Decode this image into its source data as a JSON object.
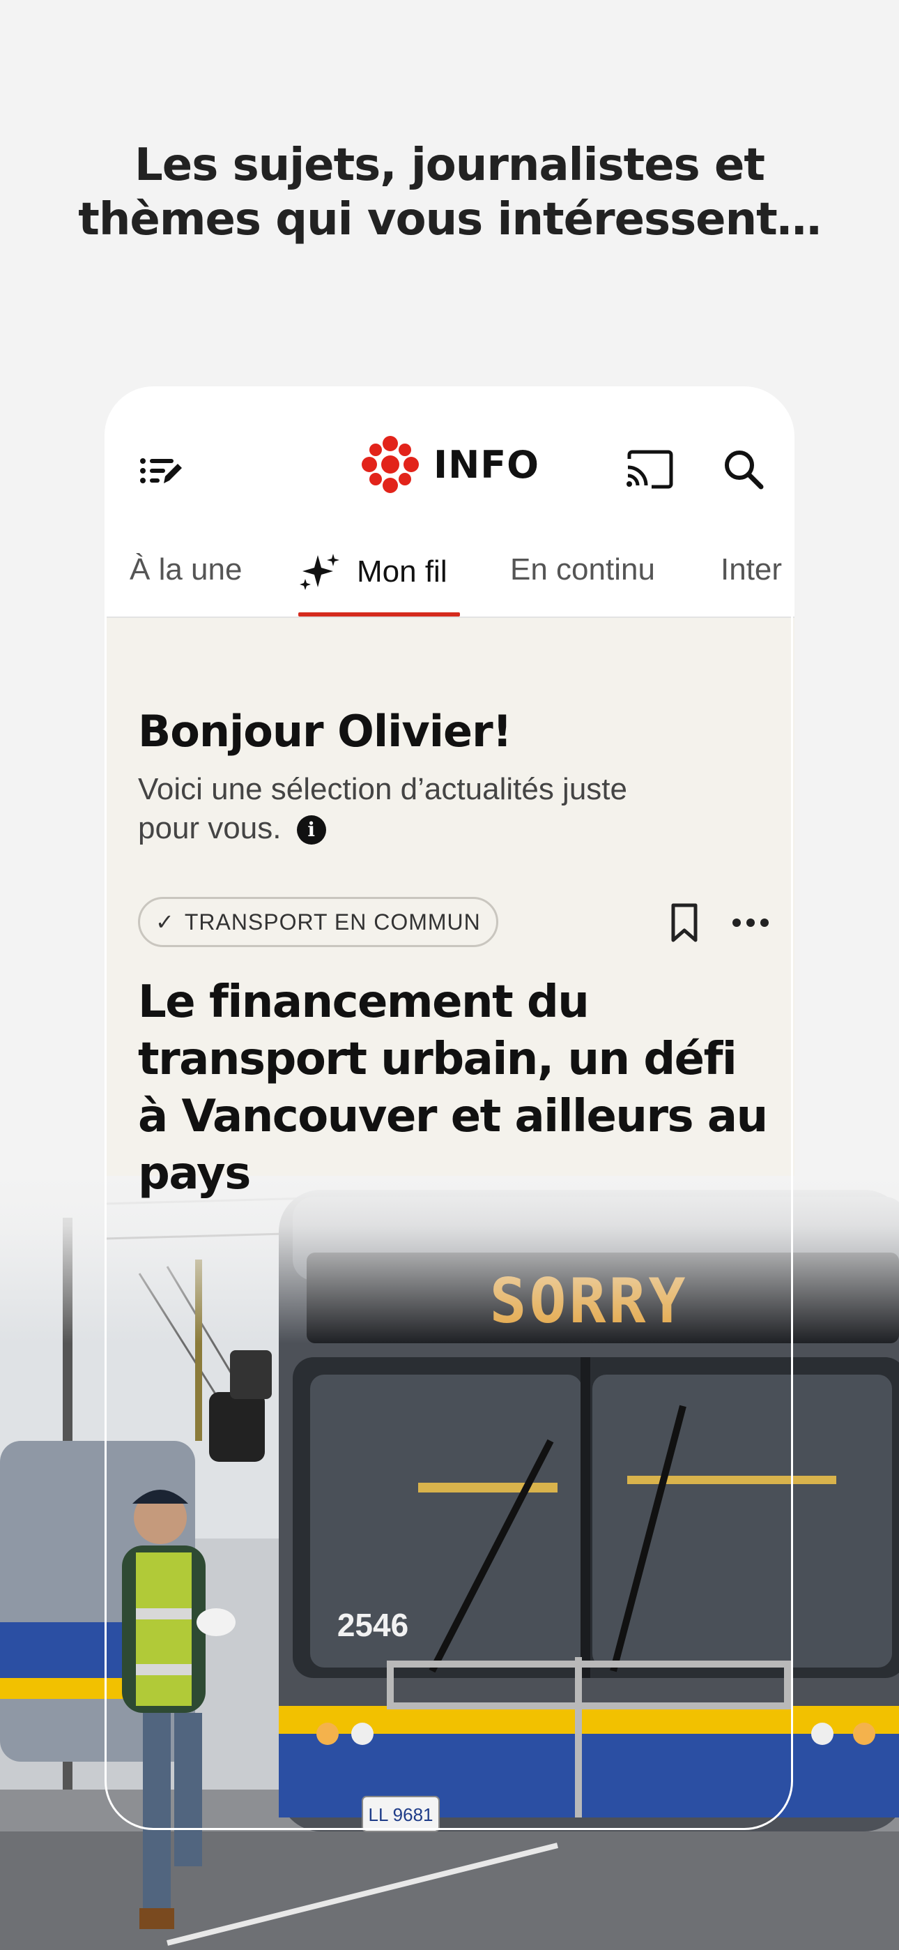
{
  "promo": {
    "title_line1": "Les sujets, journalistes et",
    "title_line2": "thèmes qui vous intéressent…"
  },
  "app": {
    "brand": "INFO",
    "icons": [
      "menu-edit-icon",
      "cast-icon",
      "search-icon"
    ],
    "accent_color": "#d52b1e"
  },
  "tabs": [
    {
      "label": "À la une",
      "active": false
    },
    {
      "label": "Mon fil",
      "active": true
    },
    {
      "label": "En continu",
      "active": false
    },
    {
      "label": "Inter",
      "active": false
    }
  ],
  "feed": {
    "greeting": "Bonjour Olivier!",
    "subtitle": "Voici une sélection d’actualités juste pour vous.",
    "info_icon": "i"
  },
  "article": {
    "tag": "TRANSPORT EN COMMUN",
    "headline": "Le financement du transport urbain, un défi à Vancouver et ailleurs au pays"
  },
  "photo": {
    "sign": "SORRY",
    "bus_number": "2546",
    "plate": "LL 9681"
  }
}
